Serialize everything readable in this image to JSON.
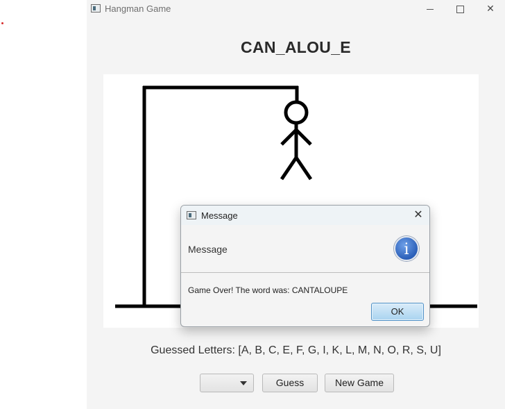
{
  "window": {
    "title": "Hangman Game",
    "icons": [
      "app-icon",
      "minimize-icon",
      "maximize-icon",
      "close-icon"
    ]
  },
  "game": {
    "masked_word": "CAN_ALOU_E",
    "guessed_letters_text": "Guessed Letters: [A, B, C, E, F, G, I, K, L, M, N, O, R, S, U]",
    "letter_select_value": "",
    "guess_button_label": "Guess",
    "new_game_button_label": "New Game"
  },
  "dialog": {
    "title": "Message",
    "header": "Message",
    "content": "Game Over! The word was: CANTALOUPE",
    "ok_label": "OK",
    "close_glyph": "✕",
    "info_glyph": "i"
  },
  "colors": {
    "window_bg": "#f4f4f4",
    "canvas_bg": "#ffffff",
    "drawing_stroke": "#000000",
    "ok_button_accent": "#4d8fc6",
    "info_icon": "#2b5fb8"
  }
}
